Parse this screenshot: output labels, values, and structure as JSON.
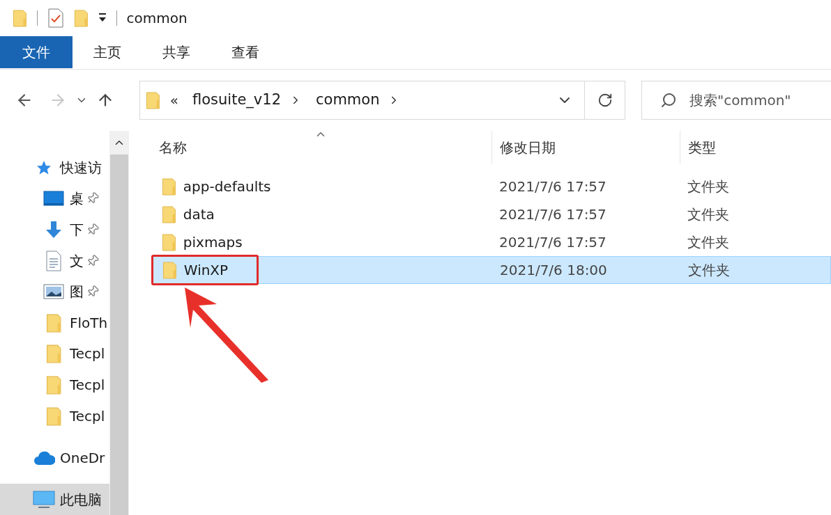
{
  "title_bar": {
    "title": "common"
  },
  "ribbon_tabs": [
    {
      "label": "文件",
      "selected": true
    },
    {
      "label": "主页",
      "selected": false
    },
    {
      "label": "共享",
      "selected": false
    },
    {
      "label": "查看",
      "selected": false
    }
  ],
  "address_bar": {
    "overflow": "«",
    "path": [
      "flosuite_v12",
      "common"
    ]
  },
  "search": {
    "placeholder": "搜索\"common\""
  },
  "sidebar": {
    "items": [
      {
        "kind": "star",
        "label": "快速访",
        "selected": false,
        "children": [
          {
            "kind": "desktop",
            "label": "桌",
            "pinned": true,
            "selected": false
          },
          {
            "kind": "download",
            "label": "下",
            "pinned": true,
            "selected": false
          },
          {
            "kind": "document",
            "label": "文",
            "pinned": true,
            "selected": false
          },
          {
            "kind": "picture",
            "label": "图",
            "pinned": true,
            "selected": false
          },
          {
            "kind": "folder",
            "label": "FloTh",
            "pinned": false,
            "selected": false
          },
          {
            "kind": "folder",
            "label": "Tecpl",
            "pinned": false,
            "selected": false
          },
          {
            "kind": "folder",
            "label": "Tecpl",
            "pinned": false,
            "selected": false
          },
          {
            "kind": "folder",
            "label": "Tecpl",
            "pinned": false,
            "selected": false
          }
        ]
      },
      {
        "kind": "cloud",
        "label": "OneDr",
        "selected": false
      },
      {
        "kind": "pc",
        "label": "此电脑",
        "selected": true
      }
    ]
  },
  "table": {
    "columns": [
      "名称",
      "修改日期",
      "类型"
    ],
    "rows": [
      {
        "name": "app-defaults",
        "modified": "2021/7/6 17:57",
        "type": "文件夹",
        "selected": false,
        "highlighted": false
      },
      {
        "name": "data",
        "modified": "2021/7/6 17:57",
        "type": "文件夹",
        "selected": false,
        "highlighted": false
      },
      {
        "name": "pixmaps",
        "modified": "2021/7/6 17:57",
        "type": "文件夹",
        "selected": false,
        "highlighted": false
      },
      {
        "name": "WinXP",
        "modified": "2021/7/6 18:00",
        "type": "文件夹",
        "selected": true,
        "highlighted": true
      }
    ]
  }
}
